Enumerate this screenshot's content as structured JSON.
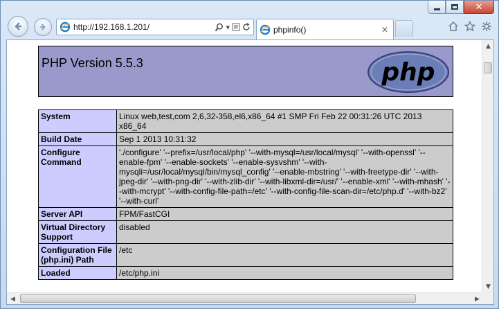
{
  "browser": {
    "address_url": "http://192.168.1.201/",
    "tab_title": "phpinfo()",
    "tab_close_glyph": "✕"
  },
  "page": {
    "header_title": "PHP Version 5.5.3",
    "logo_text": "php",
    "rows": [
      {
        "label": "System",
        "value": "Linux web,test,com 2,6,32-358,el6,x86_64 #1 SMP Fri Feb 22 00:31:26 UTC 2013 x86_64"
      },
      {
        "label": "Build Date",
        "value": "Sep 1 2013 10:31:32"
      },
      {
        "label": "Configure Command",
        "value": "'./configure' '--prefix=/usr/local/php' '--with-mysql=/usr/local/mysql' '--with-openssl' '--enable-fpm' '--enable-sockets' '--enable-sysvshm' '--with-mysqli=/usr/local/mysql/bin/mysql_config' '--enable-mbstring' '--with-freetype-dir' '--with-jpeg-dir' '--with-png-dir' '--with-zlib-dir' '--with-libxml-dir=/usr/' '--enable-xml' '--with-mhash' '--with-mcrypt' '--with-config-file-path=/etc' '--with-config-file-scan-dir=/etc/php.d' '--with-bz2' '--with-curl'"
      },
      {
        "label": "Server API",
        "value": "FPM/FastCGI"
      },
      {
        "label": "Virtual Directory Support",
        "value": "disabled"
      },
      {
        "label": "Configuration File (php.ini) Path",
        "value": "/etc"
      },
      {
        "label": "Loaded",
        "value": "/etc/php.ini"
      }
    ]
  },
  "colors": {
    "header_bg": "#9999cc",
    "label_bg": "#ccccff",
    "value_bg": "#cccccc"
  }
}
